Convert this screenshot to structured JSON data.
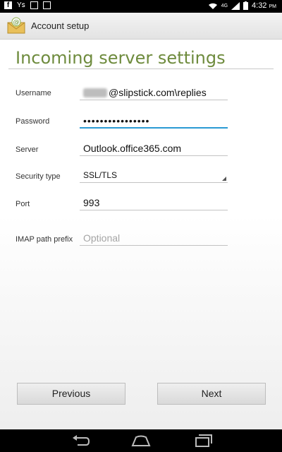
{
  "status_bar": {
    "left_icons": [
      "facebook-icon",
      "y-icon",
      "image-icon",
      "image-icon"
    ],
    "y_label": "Y",
    "network": "4G",
    "time": "4:32",
    "time_suffix": "PM"
  },
  "action_bar": {
    "title": "Account setup",
    "icon": "email-icon"
  },
  "page": {
    "title": "Incoming server settings"
  },
  "form": {
    "username": {
      "label": "Username",
      "value_suffix": "@slipstick.com\\replies"
    },
    "password": {
      "label": "Password",
      "value": "••••••••••••••••"
    },
    "server": {
      "label": "Server",
      "value": "Outlook.office365.com"
    },
    "security_type": {
      "label": "Security type",
      "value": "SSL/TLS"
    },
    "port": {
      "label": "Port",
      "value": "993"
    },
    "imap_path_prefix": {
      "label": "IMAP path prefix",
      "placeholder": "Optional"
    }
  },
  "buttons": {
    "previous": "Previous",
    "next": "Next"
  },
  "nav_bar": [
    "back-icon",
    "home-icon",
    "recents-icon"
  ],
  "colors": {
    "title_green": "#6e8b3d",
    "focus_blue": "#2a9ad4"
  }
}
